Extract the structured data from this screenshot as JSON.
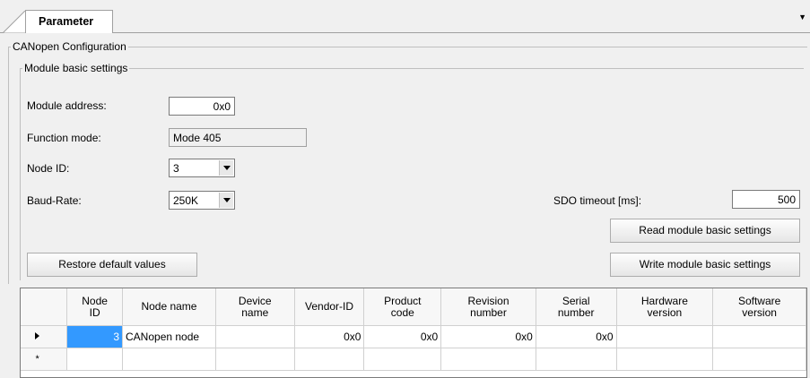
{
  "tab": {
    "label": "Parameter"
  },
  "groups": {
    "outer": "CANopen Configuration",
    "inner": "Module basic settings"
  },
  "fields": {
    "module_address": {
      "label": "Module address:",
      "value": "0x0"
    },
    "function_mode": {
      "label": "Function mode:",
      "value": "Mode 405"
    },
    "node_id": {
      "label": "Node ID:",
      "value": "3"
    },
    "baud_rate": {
      "label": "Baud-Rate:",
      "value": "250K"
    },
    "sdo_timeout": {
      "label": "SDO timeout [ms]:",
      "value": "500"
    }
  },
  "buttons": {
    "read": "Read module basic settings",
    "write": "Write module basic settings",
    "restore": "Restore default values"
  },
  "table": {
    "columns": [
      {
        "line1": "Node",
        "line2": "ID"
      },
      {
        "line1": "Node name",
        "line2": ""
      },
      {
        "line1": "Device",
        "line2": "name"
      },
      {
        "line1": "Vendor-ID",
        "line2": ""
      },
      {
        "line1": "Product",
        "line2": "code"
      },
      {
        "line1": "Revision",
        "line2": "number"
      },
      {
        "line1": "Serial",
        "line2": "number"
      },
      {
        "line1": "Hardware",
        "line2": "version"
      },
      {
        "line1": "Software",
        "line2": "version"
      }
    ],
    "rows": [
      {
        "node_id": "3",
        "node_name": "CANopen node",
        "device_name": "",
        "vendor_id": "0x0",
        "product_code": "0x0",
        "revision": "0x0",
        "serial": "0x0",
        "hardware": "",
        "software": ""
      }
    ],
    "new_row_marker": "*"
  }
}
